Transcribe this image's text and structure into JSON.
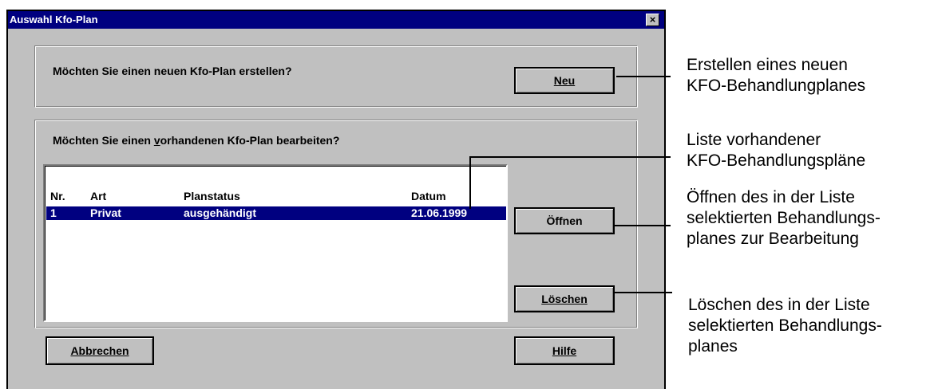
{
  "dialog": {
    "title": "Auswahl Kfo-Plan",
    "close_glyph": "×"
  },
  "new_section": {
    "prompt": "Möchten Sie einen neuen Kfo-Plan erstellen?",
    "button_label": "Neu"
  },
  "existing_section": {
    "prompt_before": "Möchten Sie einen ",
    "prompt_underlined": "v",
    "prompt_after": "orhandenen Kfo-Plan bearbeiten?",
    "columns": [
      "Nr.",
      "Art",
      "Planstatus",
      "Datum"
    ],
    "rows": [
      {
        "nr": "1",
        "art": "Privat",
        "status": "ausgehändigt",
        "datum": "21.06.1999",
        "selected": true
      }
    ],
    "open_button": "Öffnen",
    "delete_button": "Löschen"
  },
  "footer": {
    "cancel_button": "Abbrechen",
    "help_button": "Hilfe"
  },
  "annotations": {
    "new": [
      "Erstellen eines neuen",
      "KFO-Behandlungplanes"
    ],
    "list": [
      "Liste vorhandener",
      "KFO-Behandlungspläne"
    ],
    "open": [
      "Öffnen des in der Liste",
      "selektierten Behandlungs-",
      "planes zur Bearbeitung"
    ],
    "delete": [
      "Löschen des in der Liste",
      "selektierten Behandlungs-",
      "planes"
    ]
  },
  "colors": {
    "titlebar": "#000080",
    "dialog_bg": "#c0c0c0",
    "selection": "#000080"
  }
}
